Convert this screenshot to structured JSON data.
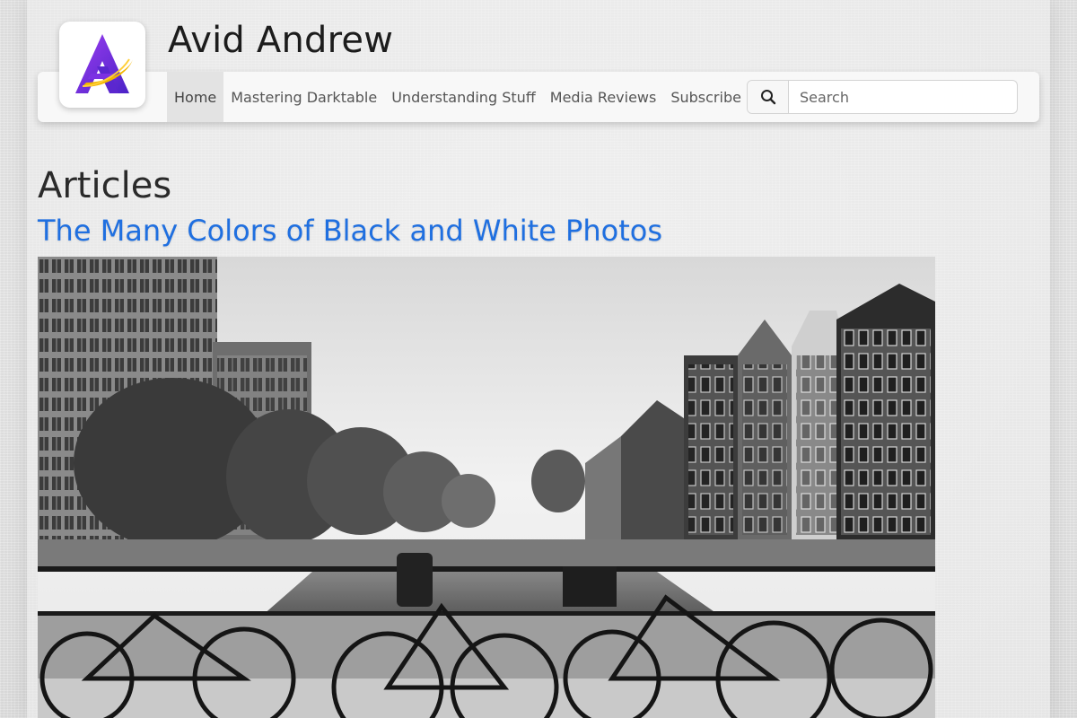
{
  "site": {
    "title": "Avid Andrew"
  },
  "nav": {
    "items": [
      {
        "label": "Home",
        "active": true
      },
      {
        "label": "Mastering Darktable",
        "active": false
      },
      {
        "label": "Understanding Stuff",
        "active": false
      },
      {
        "label": "Media Reviews",
        "active": false
      },
      {
        "label": "Subscribe",
        "active": false
      }
    ]
  },
  "search": {
    "placeholder": "Search",
    "value": ""
  },
  "main": {
    "heading": "Articles",
    "articles": [
      {
        "title": "The Many Colors of Black and White Photos",
        "image": "black-and-white canal street with bicycles on bridge railing"
      }
    ]
  },
  "colors": {
    "link": "#1f6fe0",
    "navbar": "#f8f8f8",
    "active_nav": "#e3e3e3",
    "logo_purple": "#6a2bd6",
    "logo_gold": "#f0b400"
  },
  "icons": {
    "search": "search-icon",
    "logo": "site-logo-icon"
  }
}
